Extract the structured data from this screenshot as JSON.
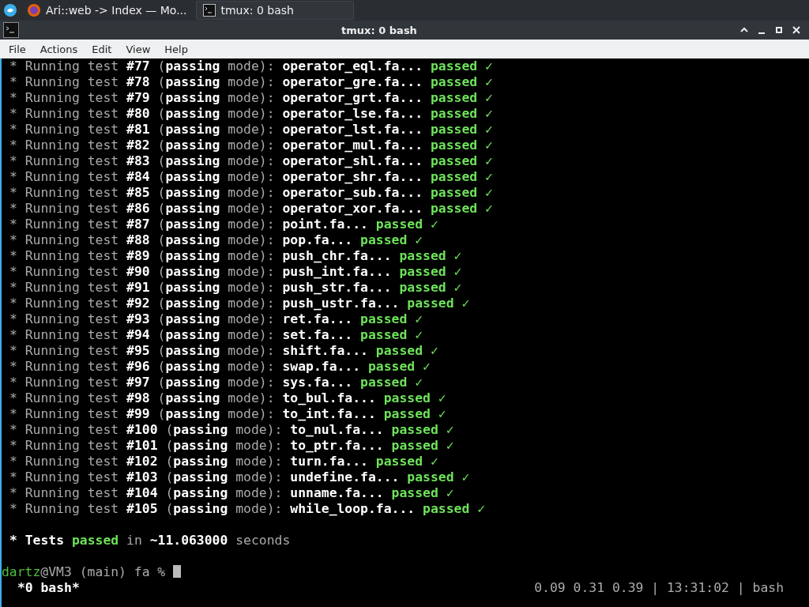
{
  "taskbar": {
    "tasks": [
      {
        "title": "Ari::web -> Index — Mo...",
        "kind": "browser",
        "selected": false
      },
      {
        "title": "tmux: 0 bash",
        "kind": "terminal",
        "selected": true
      }
    ]
  },
  "window": {
    "title": "tmux: 0 bash"
  },
  "menu": [
    "File",
    "Actions",
    "Edit",
    "View",
    "Help"
  ],
  "lines": [
    {
      "text": "* Running test **#77** (**passing** mode): **operator_eql.fa...**",
      "result": "passed",
      "mark": "✓"
    },
    {
      "text": "* Running test **#78** (**passing** mode): **operator_gre.fa...**",
      "result": "passed",
      "mark": "✓"
    },
    {
      "text": "* Running test **#79** (**passing** mode): **operator_grt.fa...**",
      "result": "passed",
      "mark": "✓"
    },
    {
      "text": "* Running test **#80** (**passing** mode): **operator_lse.fa...**",
      "result": "passed",
      "mark": "✓"
    },
    {
      "text": "* Running test **#81** (**passing** mode): **operator_lst.fa...**",
      "result": "passed",
      "mark": "✓"
    },
    {
      "text": "* Running test **#82** (**passing** mode): **operator_mul.fa...**",
      "result": "passed",
      "mark": "✓"
    },
    {
      "text": "* Running test **#83** (**passing** mode): **operator_shl.fa...**",
      "result": "passed",
      "mark": "✓"
    },
    {
      "text": "* Running test **#84** (**passing** mode): **operator_shr.fa...**",
      "result": "passed",
      "mark": "✓"
    },
    {
      "text": "* Running test **#85** (**passing** mode): **operator_sub.fa...**",
      "result": "passed",
      "mark": "✓"
    },
    {
      "text": "* Running test **#86** (**passing** mode): **operator_xor.fa...**",
      "result": "passed",
      "mark": "✓"
    },
    {
      "text": "* Running test **#87** (**passing** mode): **point.fa...**",
      "result": "passed",
      "mark": "✓"
    },
    {
      "text": "* Running test **#88** (**passing** mode): **pop.fa...**",
      "result": "passed",
      "mark": "✓"
    },
    {
      "text": "* Running test **#89** (**passing** mode): **push_chr.fa...**",
      "result": "passed",
      "mark": "✓"
    },
    {
      "text": "* Running test **#90** (**passing** mode): **push_int.fa...**",
      "result": "passed",
      "mark": "✓"
    },
    {
      "text": "* Running test **#91** (**passing** mode): **push_str.fa...**",
      "result": "passed",
      "mark": "✓"
    },
    {
      "text": "* Running test **#92** (**passing** mode): **push_ustr.fa...**",
      "result": "passed",
      "mark": "✓"
    },
    {
      "text": "* Running test **#93** (**passing** mode): **ret.fa...**",
      "result": "passed",
      "mark": "✓"
    },
    {
      "text": "* Running test **#94** (**passing** mode): **set.fa...**",
      "result": "passed",
      "mark": "✓"
    },
    {
      "text": "* Running test **#95** (**passing** mode): **shift.fa...**",
      "result": "passed",
      "mark": "✓"
    },
    {
      "text": "* Running test **#96** (**passing** mode): **swap.fa...**",
      "result": "passed",
      "mark": "✓"
    },
    {
      "text": "* Running test **#97** (**passing** mode): **sys.fa...**",
      "result": "passed",
      "mark": "✓"
    },
    {
      "text": "* Running test **#98** (**passing** mode): **to_bul.fa...**",
      "result": "passed",
      "mark": "✓"
    },
    {
      "text": "* Running test **#99** (**passing** mode): **to_int.fa...**",
      "result": "passed",
      "mark": "✓"
    },
    {
      "text": "* Running test **#100** (**passing** mode): **to_nul.fa...**",
      "result": "passed",
      "mark": "✓"
    },
    {
      "text": "* Running test **#101** (**passing** mode): **to_ptr.fa...**",
      "result": "passed",
      "mark": "✓"
    },
    {
      "text": "* Running test **#102** (**passing** mode): **turn.fa...**",
      "result": "passed",
      "mark": "✓"
    },
    {
      "text": "* Running test **#103** (**passing** mode): **undefine.fa...**",
      "result": "passed",
      "mark": "✓"
    },
    {
      "text": "* Running test **#104** (**passing** mode): **unname.fa...**",
      "result": "passed",
      "mark": "✓"
    },
    {
      "text": "* Running test **#105** (**passing** mode): **while_loop.fa...**",
      "result": "passed",
      "mark": "✓"
    }
  ],
  "summary": {
    "lead": "* Tests",
    "result": "passed",
    "rest": "in **~11.063000** seconds"
  },
  "prompt": {
    "user": "dartz",
    "rest": "@VM3 (main) fa %"
  },
  "status_bar": {
    "session": "*0 bash*",
    "info": "0.09 0.31 0.39 | 13:31:02 | bash"
  }
}
